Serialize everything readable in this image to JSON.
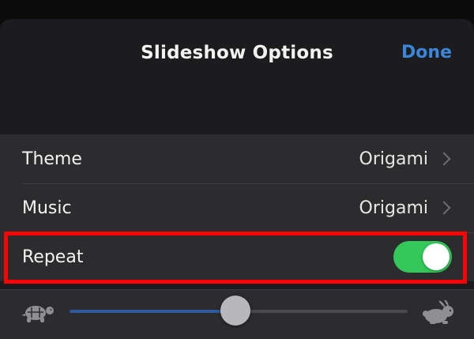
{
  "header": {
    "title": "Slideshow Options",
    "done_label": "Done"
  },
  "options": {
    "theme": {
      "label": "Theme",
      "value": "Origami"
    },
    "music": {
      "label": "Music",
      "value": "Origami"
    },
    "repeat": {
      "label": "Repeat",
      "enabled": true
    }
  },
  "speed": {
    "slow_icon": "turtle-icon",
    "fast_icon": "rabbit-icon",
    "level": 0.49
  },
  "colors": {
    "accent": "#3a86d9",
    "toggle_on": "#34c759",
    "highlight": "#ff0000",
    "slider_fill": "#2f5aa0"
  }
}
